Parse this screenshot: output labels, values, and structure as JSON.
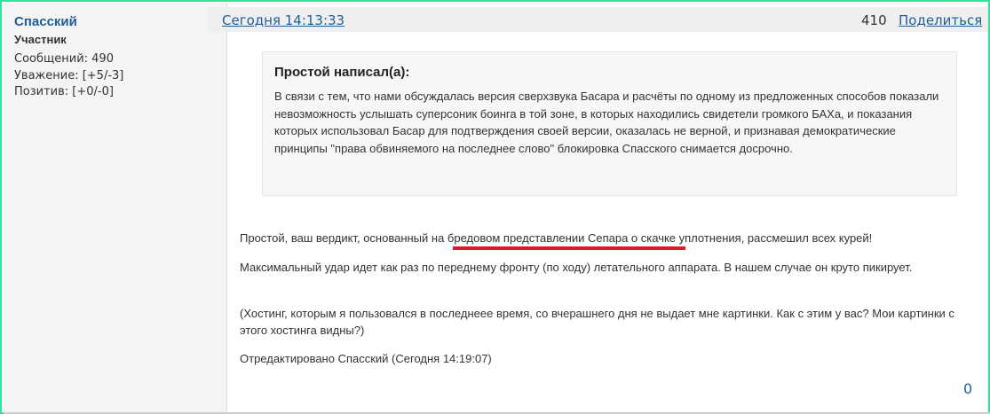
{
  "author": {
    "name": "Спасский",
    "role": "Участник",
    "stats": [
      "Сообщений: 490",
      "Уважение: [+5/-3]",
      "Позитив: [+0/-0]"
    ]
  },
  "post": {
    "date": "Сегодня 14:13:33",
    "number": "410",
    "share_label": "Поделиться",
    "quote": {
      "title": "Простой написал(а):",
      "text": "В  связи с тем, что нами обсуждалась версия сверхзвука Басара и расчёты по одному из предложенных способов показали невозможность услышать суперсоник боинга в той зоне, в которых находились свидетели громкого БАХа, и показания которых использовал Басар для подтверждения своей версии, оказалась не верной, и признавая демократические принципы \"права обвиняемого на последнее слово\" блокировка  Спасского снимается досрочно."
    },
    "paragraphs": [
      "Простой, ваш вердикт, основанный на бредовом представлении Сепара о скачке уплотнения,  рассмешил всех курей!",
      "Максимальный удар идет  как раз по переднему фронту (по ходу) летательного аппарата. В нашем случае он круто пикирует.",
      "(Хостинг, которым я пользовался в  последнеее время,  со вчерашнего дня не выдает мне картинки. Как с этим у вас? Мои картинки с этого хостинга видны?)",
      "Отредактировано Спасский (Сегодня 14:19:07)"
    ],
    "vote_count": "0"
  },
  "colors": {
    "frame_border": "#2ee59a",
    "link": "#1f5e99",
    "annotation_underline": "#e3152a"
  }
}
